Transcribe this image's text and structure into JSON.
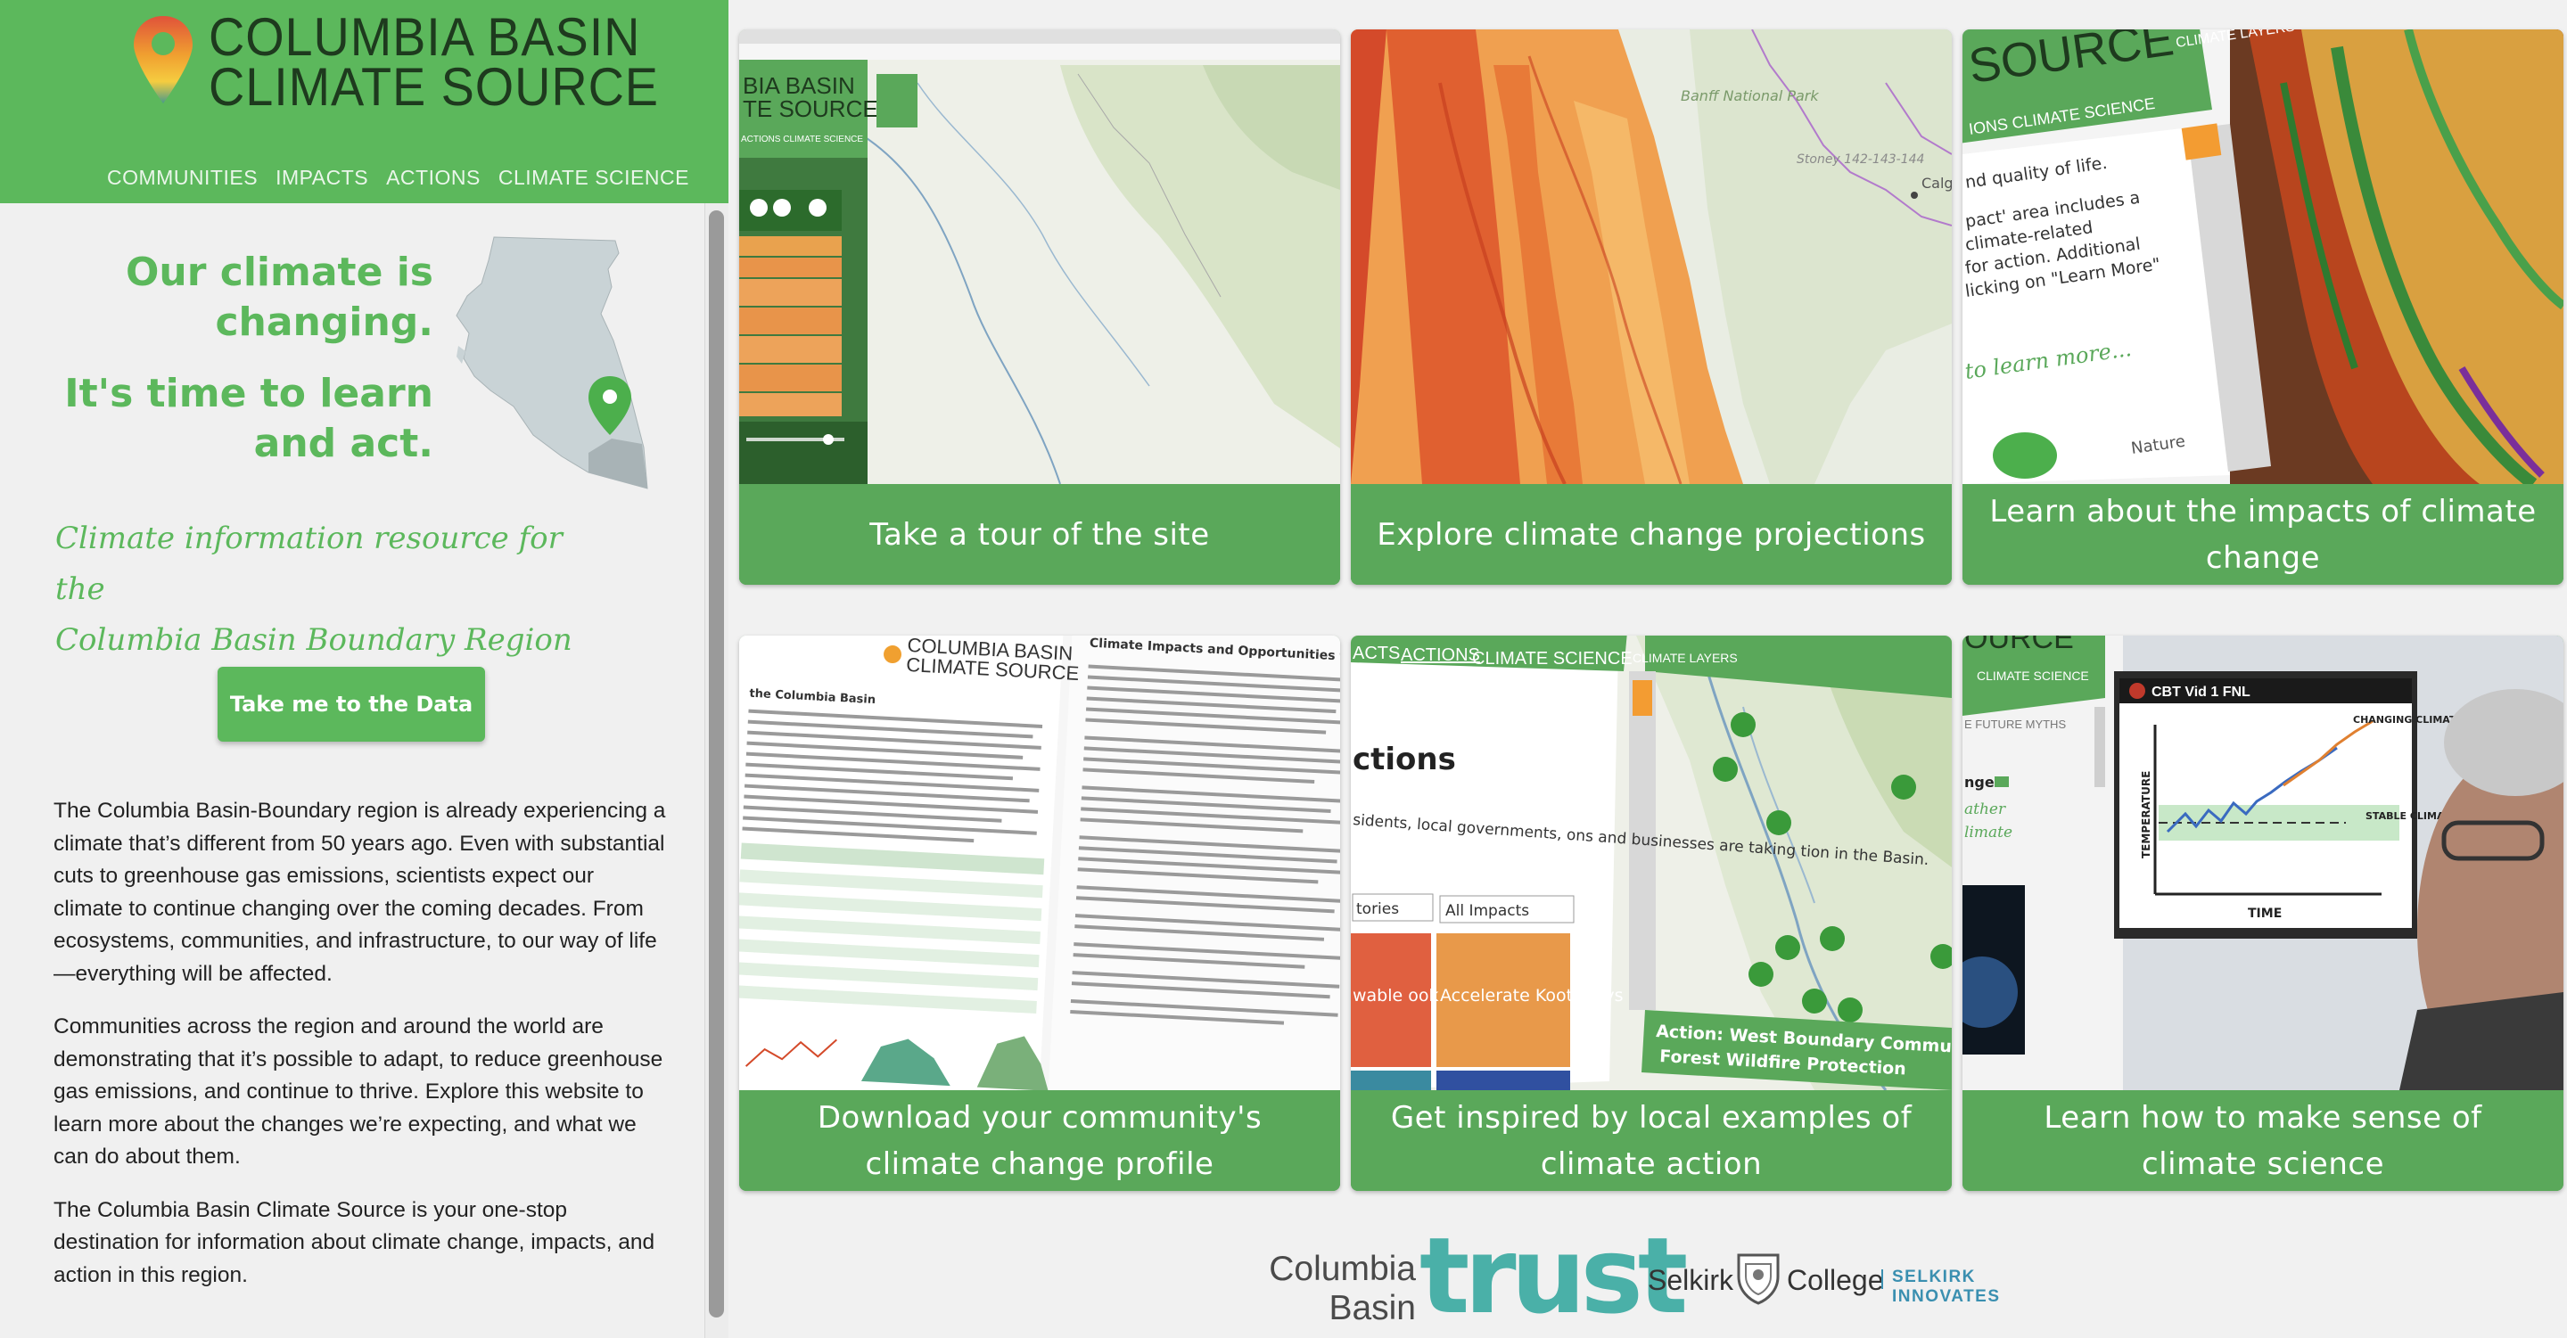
{
  "site": {
    "logo_line1": "COLUMBIA BASIN",
    "logo_line2": "CLIMATE SOURCE",
    "nav": [
      "COMMUNITIES",
      "IMPACTS",
      "ACTIONS",
      "CLIMATE SCIENCE"
    ]
  },
  "hero": {
    "line1": "Our climate is",
    "line2": "changing.",
    "line3": "It's time to learn",
    "line4": "and act.",
    "tagline_line1": "Climate information resource for the",
    "tagline_line2": "Columbia Basin Boundary Region",
    "cta_label": "Take me to the Data"
  },
  "body": {
    "p1": "The Columbia Basin-Boundary region is already experiencing a climate that’s different from 50 years ago. Even with substantial cuts to greenhouse gas emissions, scientists expect our climate to continue changing over the coming decades. From ecosystems, communities, and infrastructure, to our way of life—everything will be affected.",
    "p2": "Communities across the region and around the world are demonstrating that it’s possible to adapt, to reduce greenhouse gas emissions, and continue to thrive. Explore this website to learn more about the changes we’re expecting, and what we can do about them.",
    "p3": "The Columbia Basin Climate Source is your one-stop destination for information about climate change, impacts, and action in this region."
  },
  "cards": [
    {
      "label": "Take a tour of the site"
    },
    {
      "label": "Explore climate change projections"
    },
    {
      "label": "Learn about the impacts of climate change"
    },
    {
      "label": "Download your community's climate change profile"
    },
    {
      "label": "Get inspired by local examples of climate action"
    },
    {
      "label": "Learn how to make sense of climate science"
    }
  ],
  "card_inner_text": {
    "tour_logo1": "BIA BASIN",
    "tour_logo2": "TE SOURCE",
    "tour_nav": "ACTIONS   CLIMATE SCIENCE",
    "proj_park": "Banff National Park",
    "proj_stoney": "Stoney 142-143-144",
    "proj_calgary": "Calg",
    "impacts_logo": "SOURCE",
    "impacts_layers": "CLIMATE LAYERS",
    "impacts_nav": "IONS   CLIMATE SCIENCE",
    "impacts_text1": "nd quality of life.",
    "impacts_text2": "pact' area includes a",
    "impacts_text3": "climate-related",
    "impacts_text4": "for action. Additional",
    "impacts_text5": "licking on \"Learn More\"",
    "impacts_learn": "to learn more...",
    "impacts_nature": "Nature",
    "profile_logo1": "COLUMBIA BASIN",
    "profile_logo2": "CLIMATE SOURCE",
    "profile_heading": "Climate Impacts and Opportunities for Action",
    "profile_sub": "the Columbia Basin",
    "actions_nav1": "ACTS",
    "actions_nav2": "ACTIONS",
    "actions_nav3": "CLIMATE SCIENCE",
    "actions_title": "ctions",
    "actions_text": "sidents, local governments, ons and businesses are taking tion in the Basin.",
    "actions_select1": "tories",
    "actions_select2": "All Impacts",
    "actions_tile1": "Accelerate Kootenays",
    "actions_tile2": "wable ook",
    "actions_banner1": "Action: West Boundary Commun",
    "actions_banner2": "Forest Wildfire Protection",
    "science_logo": "OURCE",
    "science_nav": "CLIMATE SCIENCE",
    "science_sub": "E FUTURE   MYTHS",
    "science_video": "CBT Vid 1 FNL",
    "science_changing": "CHANGING CLIMATE",
    "science_stable": "STABLE CLIMATE",
    "science_temp": "TEMPERATURE",
    "science_time": "TIME"
  },
  "footer": {
    "cbt_line1": "Columbia",
    "cbt_line2": "Basin",
    "trust": "trust",
    "selkirk": "Selkirk",
    "college": "College",
    "innovates": "SELKIRK INNOVATES"
  },
  "colors": {
    "brand_green": "#5cb85c",
    "card_green": "#5aa85a",
    "logo_dark": "#1e3a1e"
  }
}
